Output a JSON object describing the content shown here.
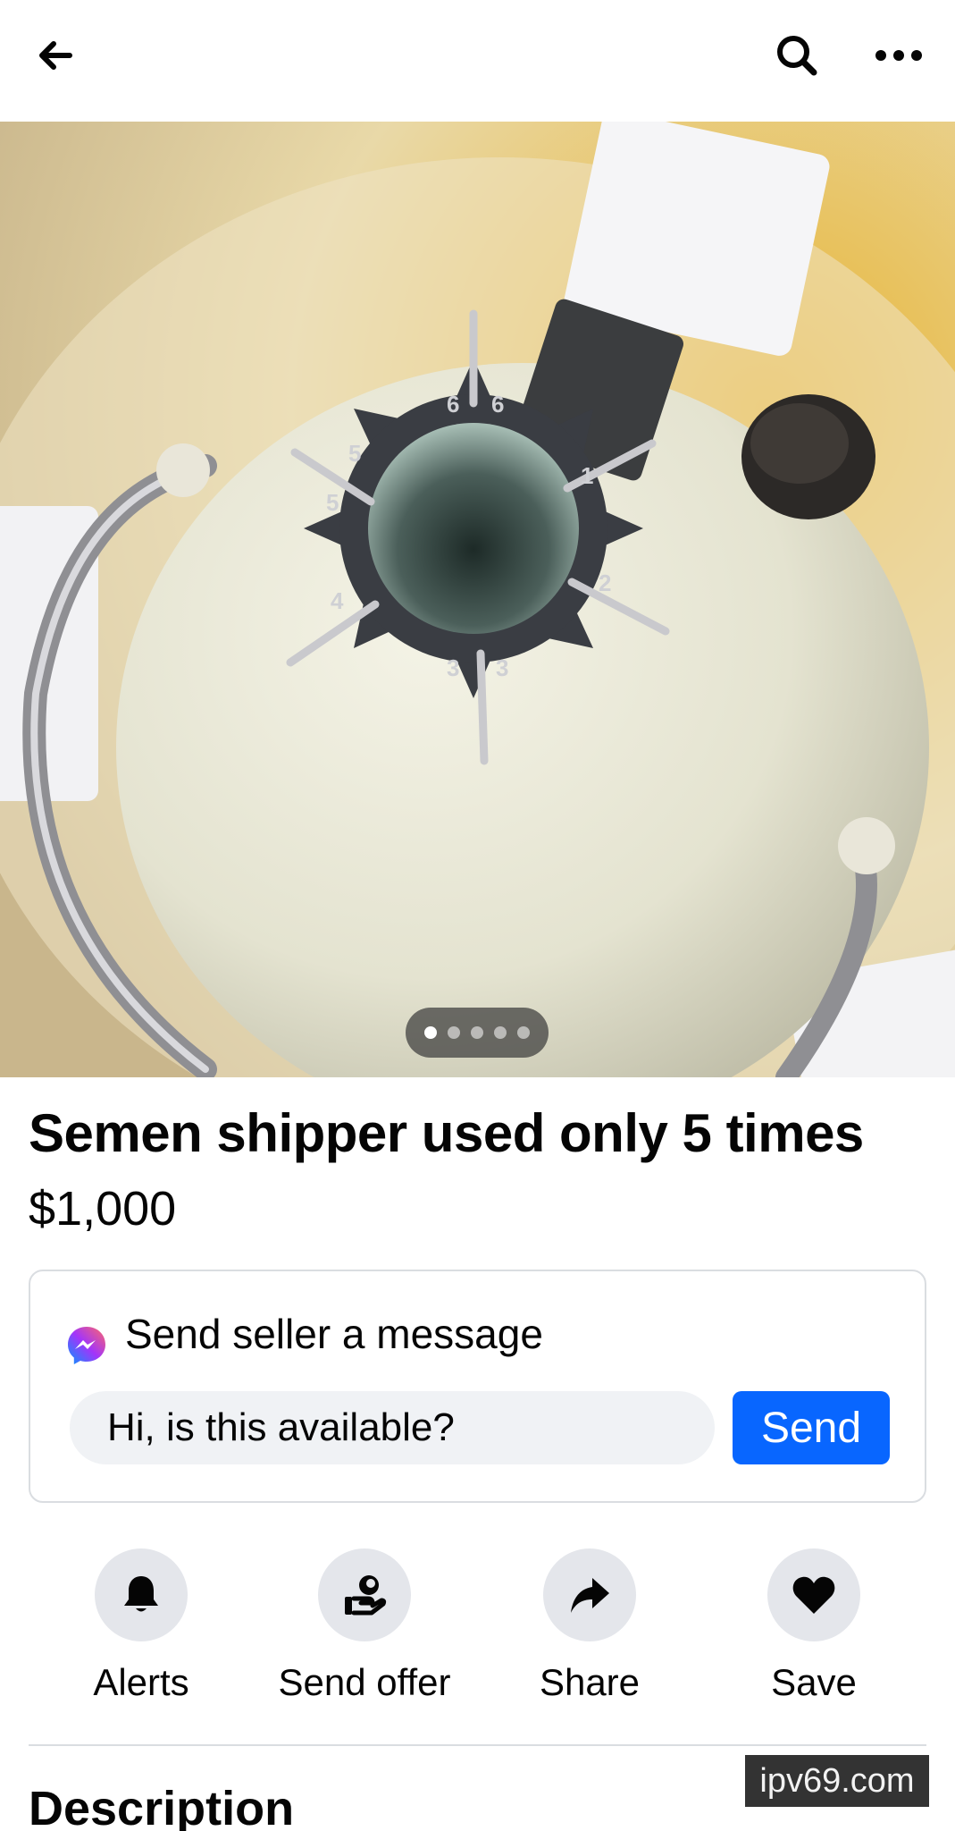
{
  "header": {
    "icons": [
      "arrow-left-icon",
      "search-icon",
      "more-horizontal-icon"
    ]
  },
  "photo": {
    "total_images": 5,
    "current_index": 1
  },
  "listing": {
    "title": "Semen shipper used only 5 times",
    "price": "$1,000"
  },
  "message": {
    "heading": "Send seller a message",
    "input_value": "Hi, is this available?",
    "send_label": "Send",
    "icon": "messenger-icon",
    "accent": "#0866ff"
  },
  "actions": [
    {
      "label": "Alerts",
      "icon": "bell-icon"
    },
    {
      "label": "Send offer",
      "icon": "offer-icon"
    },
    {
      "label": "Share",
      "icon": "share-arrow-icon"
    },
    {
      "label": "Save",
      "icon": "heart-icon"
    }
  ],
  "description": {
    "heading": "Description"
  },
  "watermark": {
    "text": "ipv69.com"
  }
}
